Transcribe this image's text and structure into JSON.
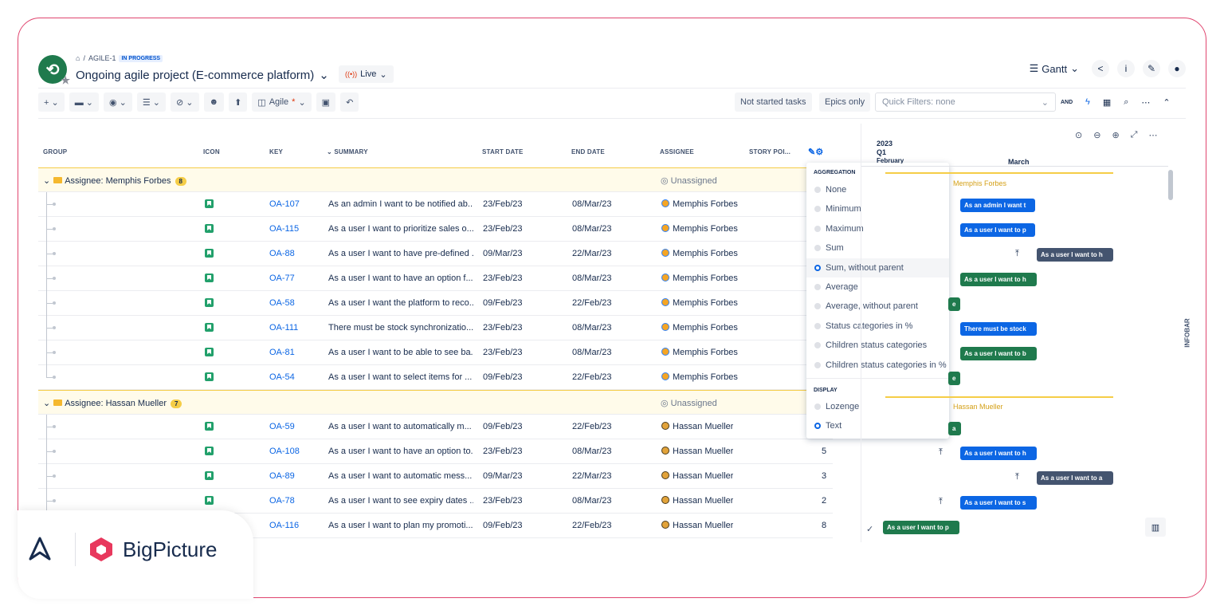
{
  "header": {
    "breadcrumb": "AGILE-1",
    "status": "IN PROGRESS",
    "title": "Ongoing agile project (E-commerce platform)",
    "live": "Live",
    "view": "Gantt"
  },
  "toolbar": {
    "view_name": "Agile",
    "not_started": "Not started tasks",
    "epics_only": "Epics only",
    "quick_filter": "Quick Filters: none",
    "and": "AND"
  },
  "columns": {
    "group": "GROUP",
    "icon": "ICON",
    "key": "KEY",
    "summary": "SUMMARY",
    "start": "START DATE",
    "end": "END DATE",
    "assignee": "ASSIGNEE",
    "story": "STORY POI..."
  },
  "groups": [
    {
      "label": "Assignee: Memphis Forbes",
      "count": "8",
      "assignee": "Unassigned",
      "rows": [
        {
          "key": "OA-107",
          "summary": "As an admin I want to be notified ab...",
          "start": "23/Feb/23",
          "end": "08/Mar/23",
          "assignee": "Memphis Forbes",
          "points": ""
        },
        {
          "key": "OA-115",
          "summary": "As a user I want to prioritize sales o...",
          "start": "23/Feb/23",
          "end": "08/Mar/23",
          "assignee": "Memphis Forbes",
          "points": ""
        },
        {
          "key": "OA-88",
          "summary": "As a user I want to have pre-defined ...",
          "start": "09/Mar/23",
          "end": "22/Mar/23",
          "assignee": "Memphis Forbes",
          "points": ""
        },
        {
          "key": "OA-77",
          "summary": "As a user I want to have an option f...",
          "start": "23/Feb/23",
          "end": "08/Mar/23",
          "assignee": "Memphis Forbes",
          "points": ""
        },
        {
          "key": "OA-58",
          "summary": "As a user I want the platform to reco...",
          "start": "09/Feb/23",
          "end": "22/Feb/23",
          "assignee": "Memphis Forbes",
          "points": ""
        },
        {
          "key": "OA-111",
          "summary": "There must be stock synchronizatio...",
          "start": "23/Feb/23",
          "end": "08/Mar/23",
          "assignee": "Memphis Forbes",
          "points": ""
        },
        {
          "key": "OA-81",
          "summary": "As a user I want to be able to see ba...",
          "start": "23/Feb/23",
          "end": "08/Mar/23",
          "assignee": "Memphis Forbes",
          "points": ""
        },
        {
          "key": "OA-54",
          "summary": "As a user I want to select items for ...",
          "start": "09/Feb/23",
          "end": "22/Feb/23",
          "assignee": "Memphis Forbes",
          "points": ""
        }
      ]
    },
    {
      "label": "Assignee: Hassan Mueller",
      "count": "7",
      "assignee": "Unassigned",
      "rows": [
        {
          "key": "OA-59",
          "summary": "As a user I want to automatically m...",
          "start": "09/Feb/23",
          "end": "22/Feb/23",
          "assignee": "Hassan Mueller",
          "points": ""
        },
        {
          "key": "OA-108",
          "summary": "As a user I want to have an option to...",
          "start": "23/Feb/23",
          "end": "08/Mar/23",
          "assignee": "Hassan Mueller",
          "points": "5"
        },
        {
          "key": "OA-89",
          "summary": "As a user I want to automatic mess...",
          "start": "09/Mar/23",
          "end": "22/Mar/23",
          "assignee": "Hassan Mueller",
          "points": "3"
        },
        {
          "key": "OA-78",
          "summary": "As a user I want to see expiry dates ...",
          "start": "23/Feb/23",
          "end": "08/Mar/23",
          "assignee": "Hassan Mueller",
          "points": "2"
        },
        {
          "key": "OA-116",
          "summary": "As a user I want to plan my promoti...",
          "start": "09/Feb/23",
          "end": "22/Feb/23",
          "assignee": "Hassan Mueller",
          "points": "8"
        }
      ]
    }
  ],
  "aggregation": {
    "title": "AGGREGATION",
    "items": [
      "None",
      "Minimum",
      "Maximum",
      "Sum",
      "Sum, without parent",
      "Average",
      "Average, without parent",
      "Status categories in %",
      "Children status categories",
      "Children status categories in %"
    ],
    "display_title": "DISPLAY",
    "display_items": [
      "Lozenge",
      "Text"
    ]
  },
  "gantt": {
    "year": "2023",
    "quarter": "Q1",
    "month_prev": "February",
    "month": "March",
    "group_label_1": "Memphis Forbes",
    "group_label_2": "Hassan Mueller",
    "bars": [
      "As an admin I want t",
      "As a user I want to p",
      "As a user I want to h",
      "As a user I want to h",
      "e",
      "There must be stock",
      "As a user I want to b",
      "e",
      "a",
      "As a user I want to h",
      "As a user I want to a",
      "As a user I want to s",
      "As a user I want to p"
    ]
  },
  "infobar": "INFOBAR",
  "brand": {
    "name": "BigPicture"
  }
}
